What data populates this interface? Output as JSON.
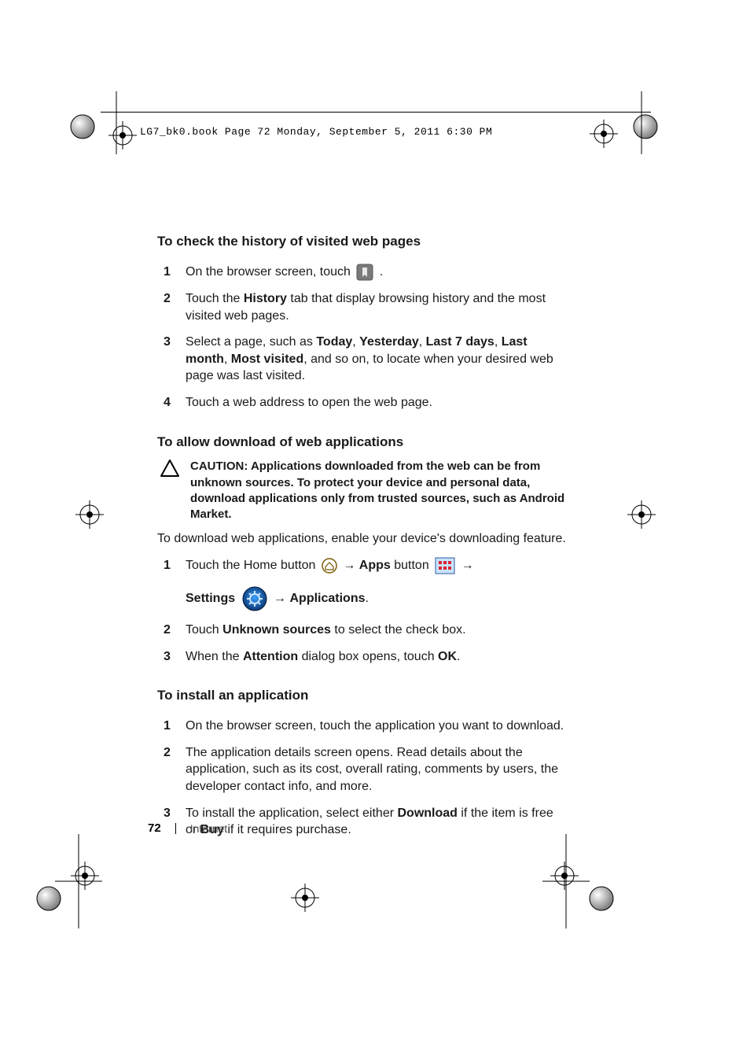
{
  "running_header": "LG7_bk0.book  Page 72  Monday, September 5, 2011  6:30 PM",
  "footer": {
    "page_number": "72",
    "section": "Internet"
  },
  "s1": {
    "heading": "To check the history of visited web pages",
    "step1_a": "On the browser screen, touch ",
    "step1_b": ".",
    "step2_a": "Touch the ",
    "step2_b": "History",
    "step2_c": " tab that display browsing history and the most visited web pages.",
    "step3_a": "Select a page, such as ",
    "step3_b": "Today",
    "step3_c": ", ",
    "step3_d": "Yesterday",
    "step3_e": ", ",
    "step3_f": "Last 7 days",
    "step3_g": ", ",
    "step3_h": "Last month",
    "step3_i": ", ",
    "step3_j": "Most visited",
    "step3_k": ", and so on, to locate when your desired web page was last visited.",
    "step4": "Touch a web address to open the web page."
  },
  "s2": {
    "heading": "To allow download of web applications",
    "caution_label": "CAUTION: ",
    "caution_text": "Applications downloaded from the web can be from unknown sources. To protect your device and personal data, download applications only from trusted sources, such as Android Market.",
    "intro": "To download web applications, enable your device's downloading feature.",
    "step1_a": "Touch the Home button ",
    "step1_b": " → ",
    "step1_c": "Apps",
    "step1_d": " button ",
    "step1_e": " →",
    "step1_row2_a": "Settings",
    "step1_row2_b": "  → ",
    "step1_row2_c": "Applications",
    "step1_row2_d": ".",
    "step2_a": "Touch ",
    "step2_b": "Unknown sources",
    "step2_c": " to select the check box.",
    "step3_a": "When the ",
    "step3_b": "Attention",
    "step3_c": " dialog box opens, touch ",
    "step3_d": "OK",
    "step3_e": "."
  },
  "s3": {
    "heading": "To install an application",
    "step1": "On the browser screen, touch the application you want to download.",
    "step2": "The application details screen opens. Read details about the application, such as its cost, overall rating, comments by users, the developer contact info, and more.",
    "step3_a": "To install the application, select either ",
    "step3_b": "Download",
    "step3_c": " if the item is free or ",
    "step3_d": "Buy",
    "step3_e": " if it requires purchase."
  }
}
